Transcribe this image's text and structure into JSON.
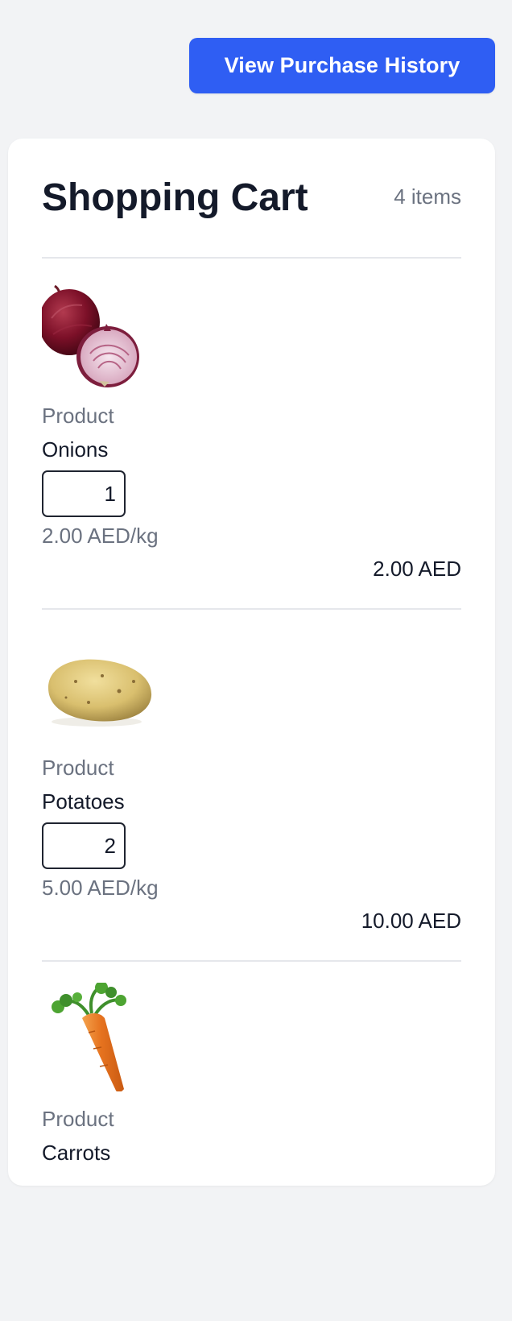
{
  "actions": {
    "purchase_history_label": "View Purchase History"
  },
  "cart": {
    "title": "Shopping Cart",
    "count": "4 items",
    "items": [
      {
        "label": "Product",
        "name": "Onions",
        "quantity": "1",
        "unit_price": "2.00 AED/kg",
        "total": "2.00 AED",
        "image": "onion-image"
      },
      {
        "label": "Product",
        "name": "Potatoes",
        "quantity": "2",
        "unit_price": "5.00 AED/kg",
        "total": "10.00 AED",
        "image": "potato-image"
      },
      {
        "label": "Product",
        "name": "Carrots",
        "image": "carrot-image"
      }
    ]
  },
  "colors": {
    "page_background": "#f2f3f5",
    "primary_button": "#2f5ef3",
    "card_background": "#ffffff",
    "heading_text": "#141a2a",
    "muted_text": "#6b7280",
    "divider": "#e5e7eb"
  }
}
